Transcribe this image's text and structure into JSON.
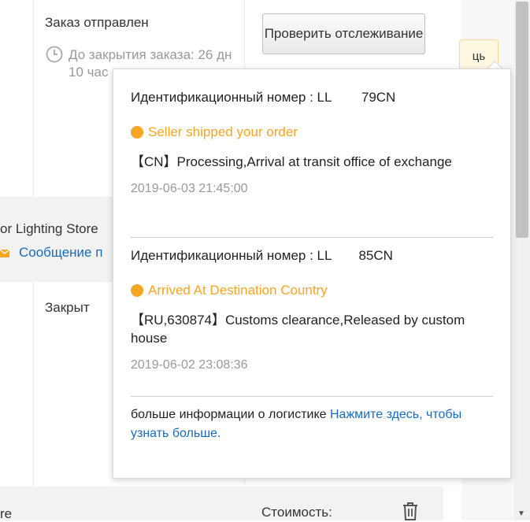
{
  "order": {
    "status": "Заказ отправлен",
    "timer_line": "До закрытия заказа: 26 дн 10 час",
    "track_button": "Проверить отслеживание",
    "side_tab": "ць",
    "store_name": "or Lighting Store",
    "message_link": "Сообщение п",
    "closed_status": "Закрыт",
    "partial_left": "re",
    "cost_label": "Стоимость:"
  },
  "popup": {
    "shipments": [
      {
        "tracking_label": "Идентификационный номер : LL           79CN",
        "event_title": "Seller shipped your order",
        "event_desc": "【CN】Processing,Arrival at transit office of exchange",
        "event_time": "2019-06-03 21:45:00"
      },
      {
        "tracking_label": "Идентификационный номер : LL          85CN",
        "event_title": "Arrived At Destination Country",
        "event_desc": "【RU,630874】Customs clearance,Released by custom house",
        "event_time": "2019-06-02 23:08:36"
      }
    ],
    "more_info_text": "больше информации о логистике ",
    "more_info_link": "Нажмите здесь, чтобы узнать больше."
  },
  "colors": {
    "accent_orange": "#f5a623",
    "link_blue": "#1a6bb5"
  }
}
